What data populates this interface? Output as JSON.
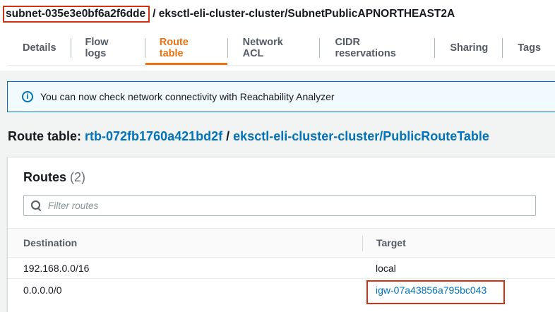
{
  "header": {
    "subnet_id": "subnet-035e3e0bf6a2f6dde",
    "subnet_name": "/ eksctl-eli-cluster-cluster/SubnetPublicAPNORTHEAST2A"
  },
  "tabs": [
    {
      "label": "Details"
    },
    {
      "label": "Flow logs"
    },
    {
      "label": "Route table",
      "active": true
    },
    {
      "label": "Network ACL"
    },
    {
      "label": "CIDR reservations"
    },
    {
      "label": "Sharing"
    },
    {
      "label": "Tags"
    }
  ],
  "alert": {
    "icon": "info-icon",
    "text": "You can now check network connectivity with Reachability Analyzer"
  },
  "route_table": {
    "label": "Route table:",
    "id": "rtb-072fb1760a421bd2f",
    "separator": "/",
    "name": "eksctl-eli-cluster-cluster/PublicRouteTable"
  },
  "routes": {
    "title": "Routes",
    "count": "(2)",
    "filter_placeholder": "Filter routes",
    "columns": {
      "destination": "Destination",
      "target": "Target"
    },
    "rows": [
      {
        "destination": "192.168.0.0/16",
        "target": "local"
      },
      {
        "destination": "0.0.0.0/0",
        "target": "igw-07a43856a795bc043"
      }
    ]
  },
  "colors": {
    "accent": "#ec7211",
    "link": "#0073bb",
    "highlight": "#d13212"
  }
}
